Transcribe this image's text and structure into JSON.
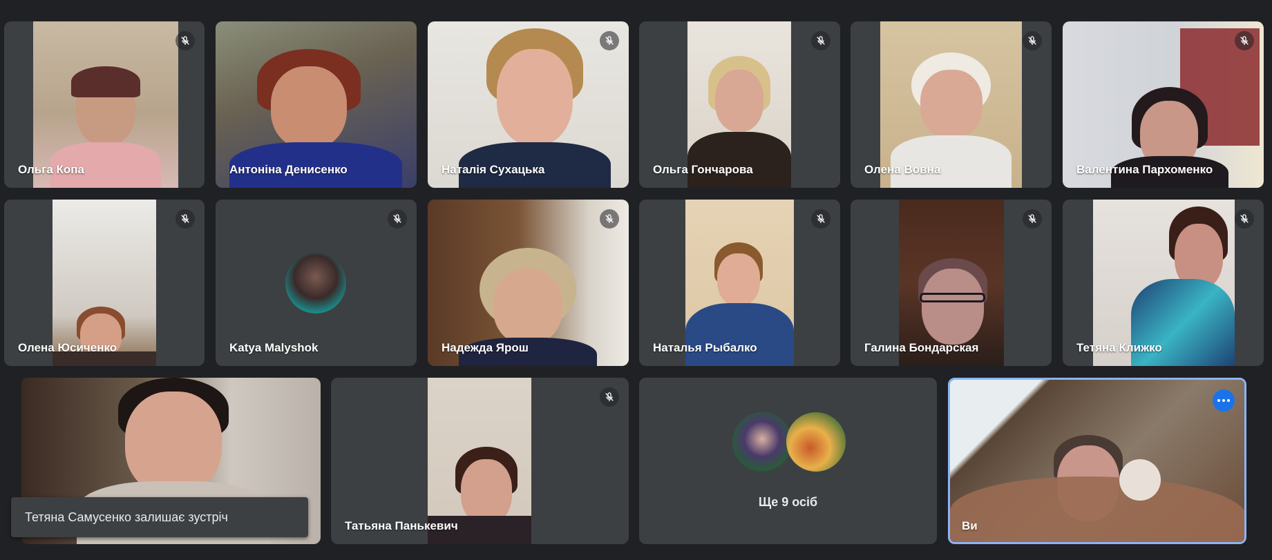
{
  "participants": [
    {
      "name": "Ольга Копа",
      "muted": true
    },
    {
      "name": "Антоніна Денисенко",
      "muted": false
    },
    {
      "name": "Наталія Сухацька",
      "muted": true
    },
    {
      "name": "Ольга Гончарова",
      "muted": true
    },
    {
      "name": "Олена Вовна",
      "muted": true
    },
    {
      "name": "Валентина Пархоменко",
      "muted": true
    },
    {
      "name": "Олена Юсиченко",
      "muted": true
    },
    {
      "name": "Katya Malyshok",
      "muted": true
    },
    {
      "name": "Надежда Ярош",
      "muted": true
    },
    {
      "name": "Наталья Рыбалко",
      "muted": true
    },
    {
      "name": "Галина Бондарская",
      "muted": true
    },
    {
      "name": "Тетяна Клижко",
      "muted": true
    },
    {
      "name": "",
      "muted": false
    },
    {
      "name": "Татьяна Панькевич",
      "muted": true
    }
  ],
  "overflow_tile": {
    "label": "Ще 9 осіб"
  },
  "self_tile": {
    "label": "Ви"
  },
  "toast": {
    "text": "Тетяна Самусенко залишає зустріч"
  },
  "colors": {
    "background": "#202124",
    "tile": "#3c4043",
    "accent": "#1a73e8",
    "self_border": "#8ab4f8"
  },
  "icons": {
    "mute": "mic-off-icon",
    "more": "more-options-icon"
  }
}
